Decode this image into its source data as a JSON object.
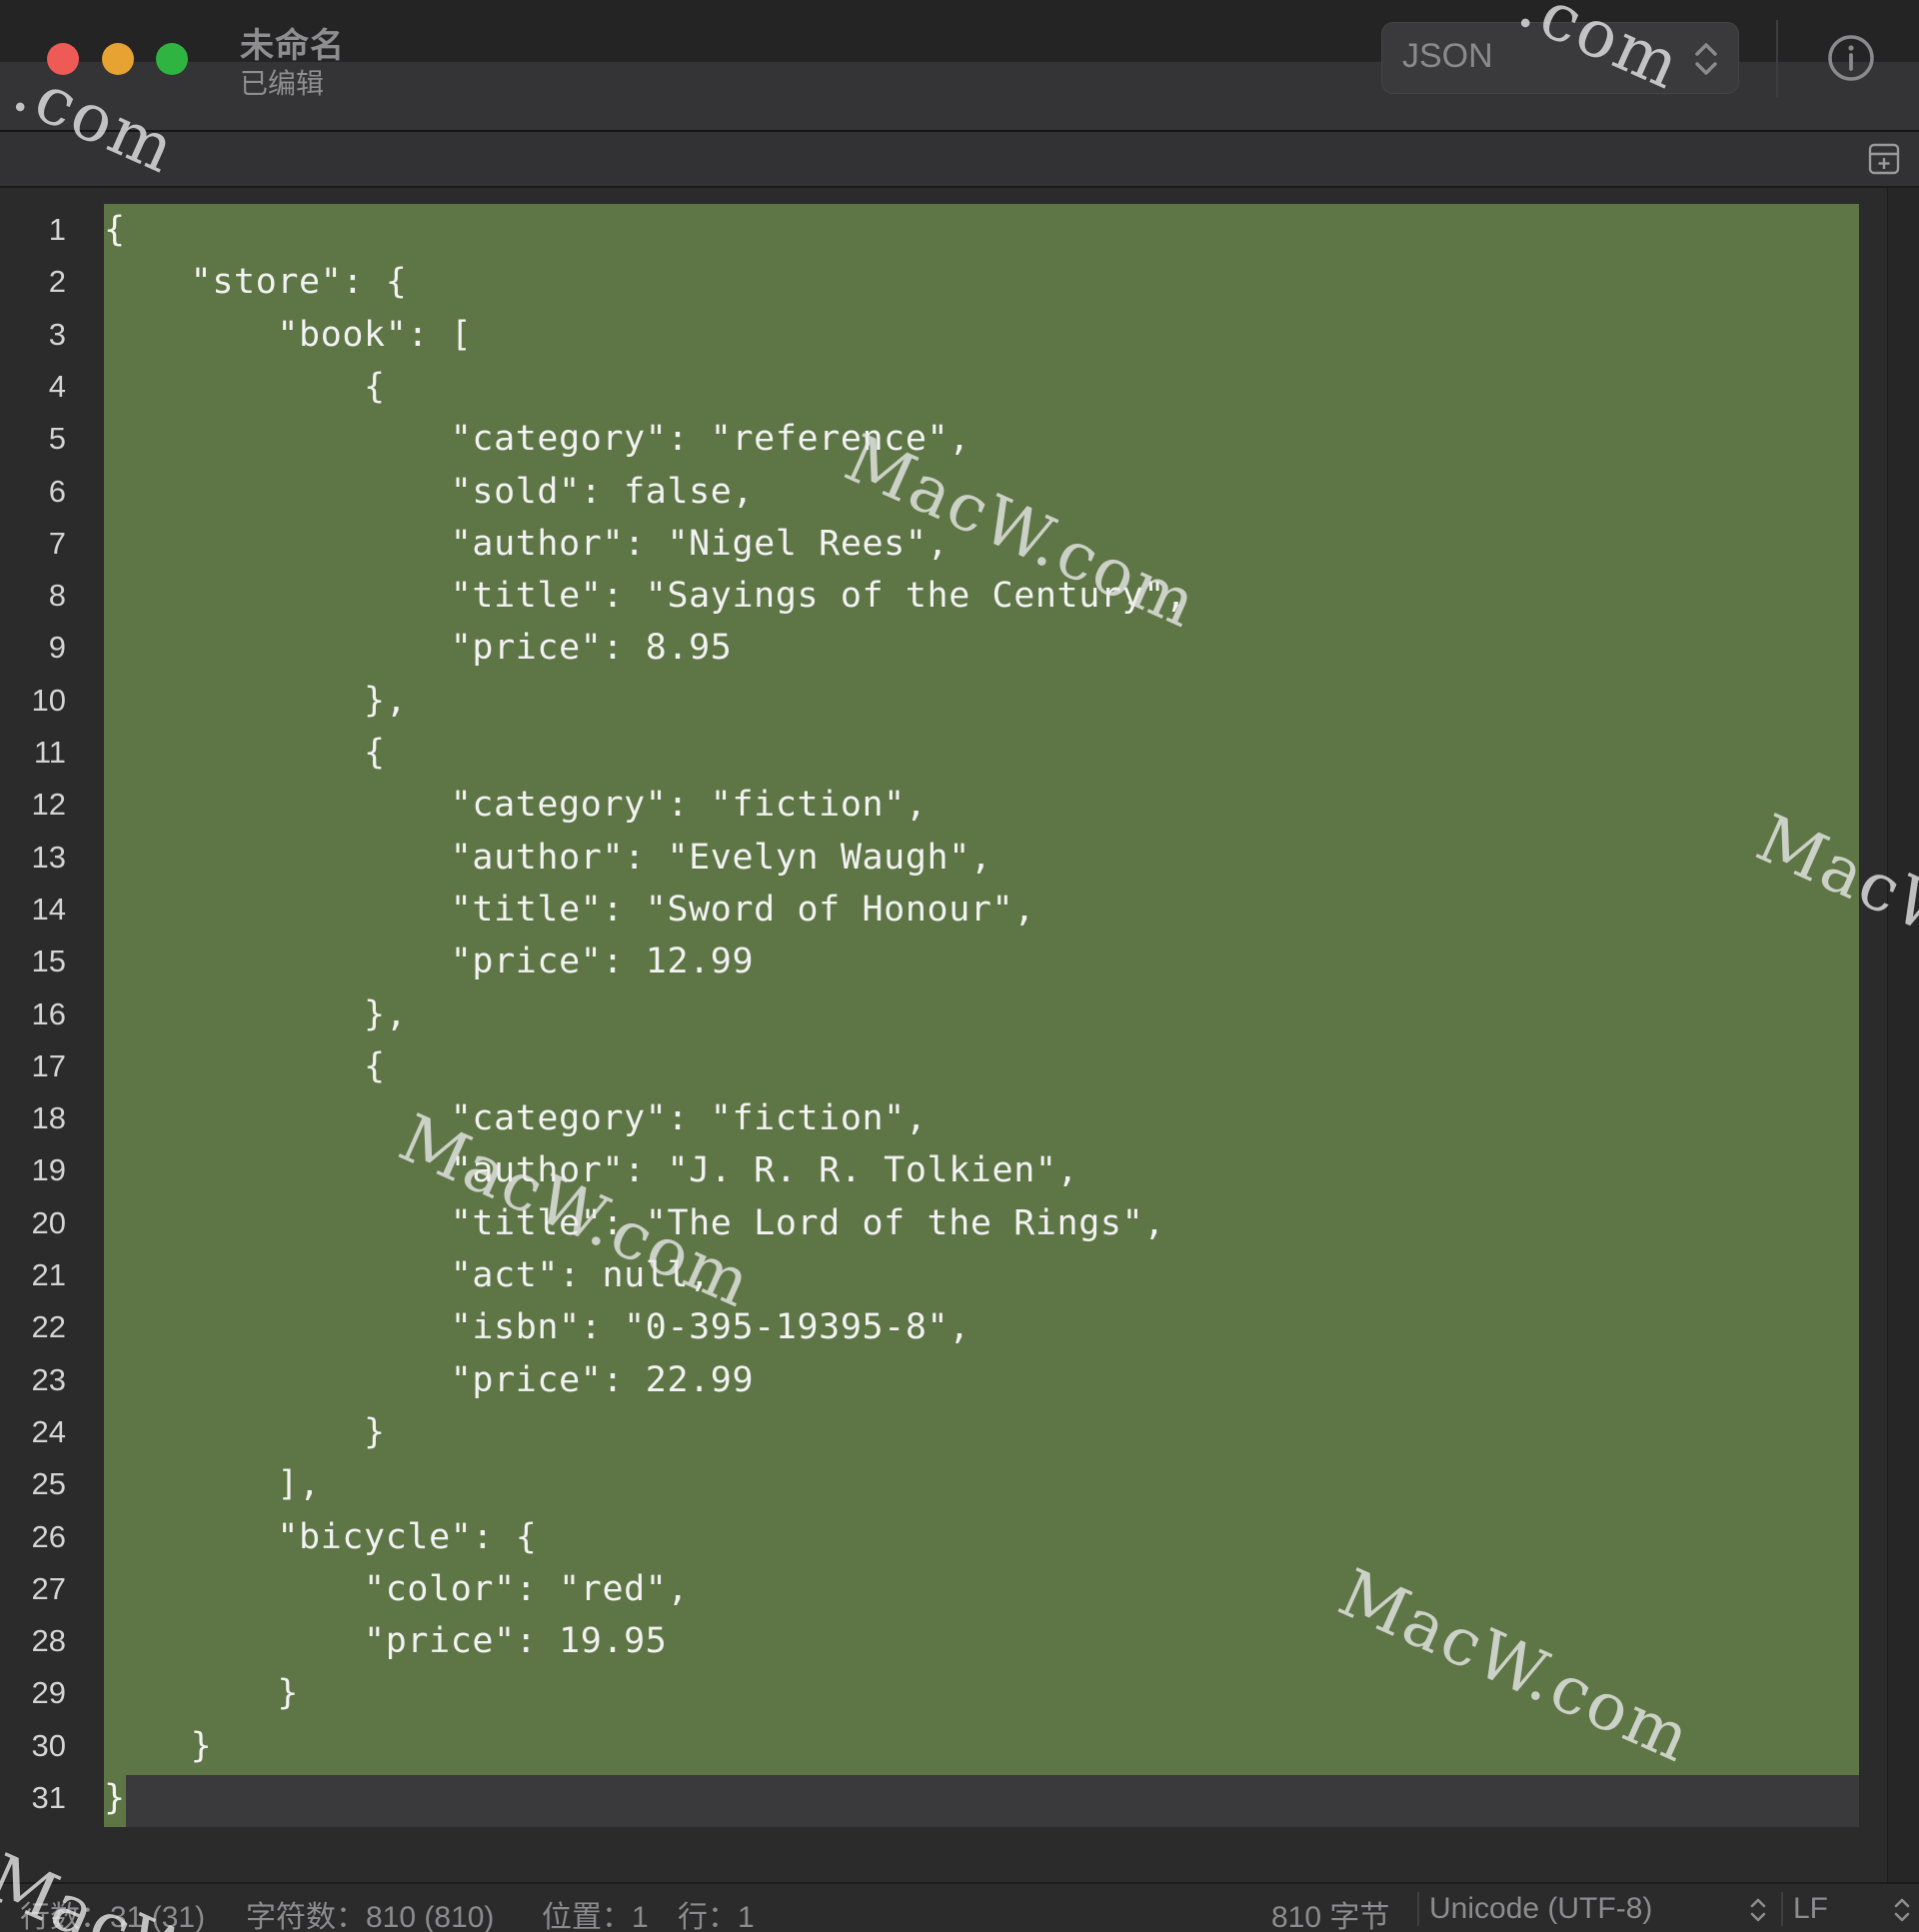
{
  "window": {
    "title": "未命名",
    "status": "已编辑"
  },
  "toolbar": {
    "format_select": "JSON",
    "info_icon": "info-icon",
    "add_pane_icon": "add-pane-icon"
  },
  "editor": {
    "line_numbers": [
      "1",
      "2",
      "3",
      "4",
      "5",
      "6",
      "7",
      "8",
      "9",
      "10",
      "11",
      "12",
      "13",
      "14",
      "15",
      "16",
      "17",
      "18",
      "19",
      "20",
      "21",
      "22",
      "23",
      "24",
      "25",
      "26",
      "27",
      "28",
      "29",
      "30",
      "31"
    ],
    "lines": [
      "{",
      "    \"store\": {",
      "        \"book\": [",
      "            {",
      "                \"category\": \"reference\",",
      "                \"sold\": false,",
      "                \"author\": \"Nigel Rees\",",
      "                \"title\": \"Sayings of the Century\",",
      "                \"price\": 8.95",
      "            },",
      "            {",
      "                \"category\": \"fiction\",",
      "                \"author\": \"Evelyn Waugh\",",
      "                \"title\": \"Sword of Honour\",",
      "                \"price\": 12.99",
      "            },",
      "            {",
      "                \"category\": \"fiction\",",
      "                \"author\": \"J. R. R. Tolkien\",",
      "                \"title\": \"The Lord of the Rings\",",
      "                \"act\": null,",
      "                \"isbn\": \"0-395-19395-8\",",
      "                \"price\": 22.99",
      "            }",
      "        ],",
      "        \"bicycle\": {",
      "            \"color\": \"red\",",
      "            \"price\": 19.95",
      "        }",
      "    }",
      "}"
    ],
    "selection_color": "#5e7545"
  },
  "statusbar": {
    "lines": "行数：31 (31)",
    "chars": "字符数：810 (810)",
    "position": "位置：1",
    "row": "行：1",
    "bytes": "810 字节",
    "encoding": "Unicode (UTF-8)",
    "line_ending": "LF"
  },
  "watermarks": [
    "MacW.com",
    "MacW.com",
    "MacW.com",
    "MacW.com",
    "MacW",
    "MacW",
    ".com"
  ],
  "colors": {
    "close": "#ee5a55",
    "minimize": "#e7a331",
    "zoom": "#2fb442"
  }
}
